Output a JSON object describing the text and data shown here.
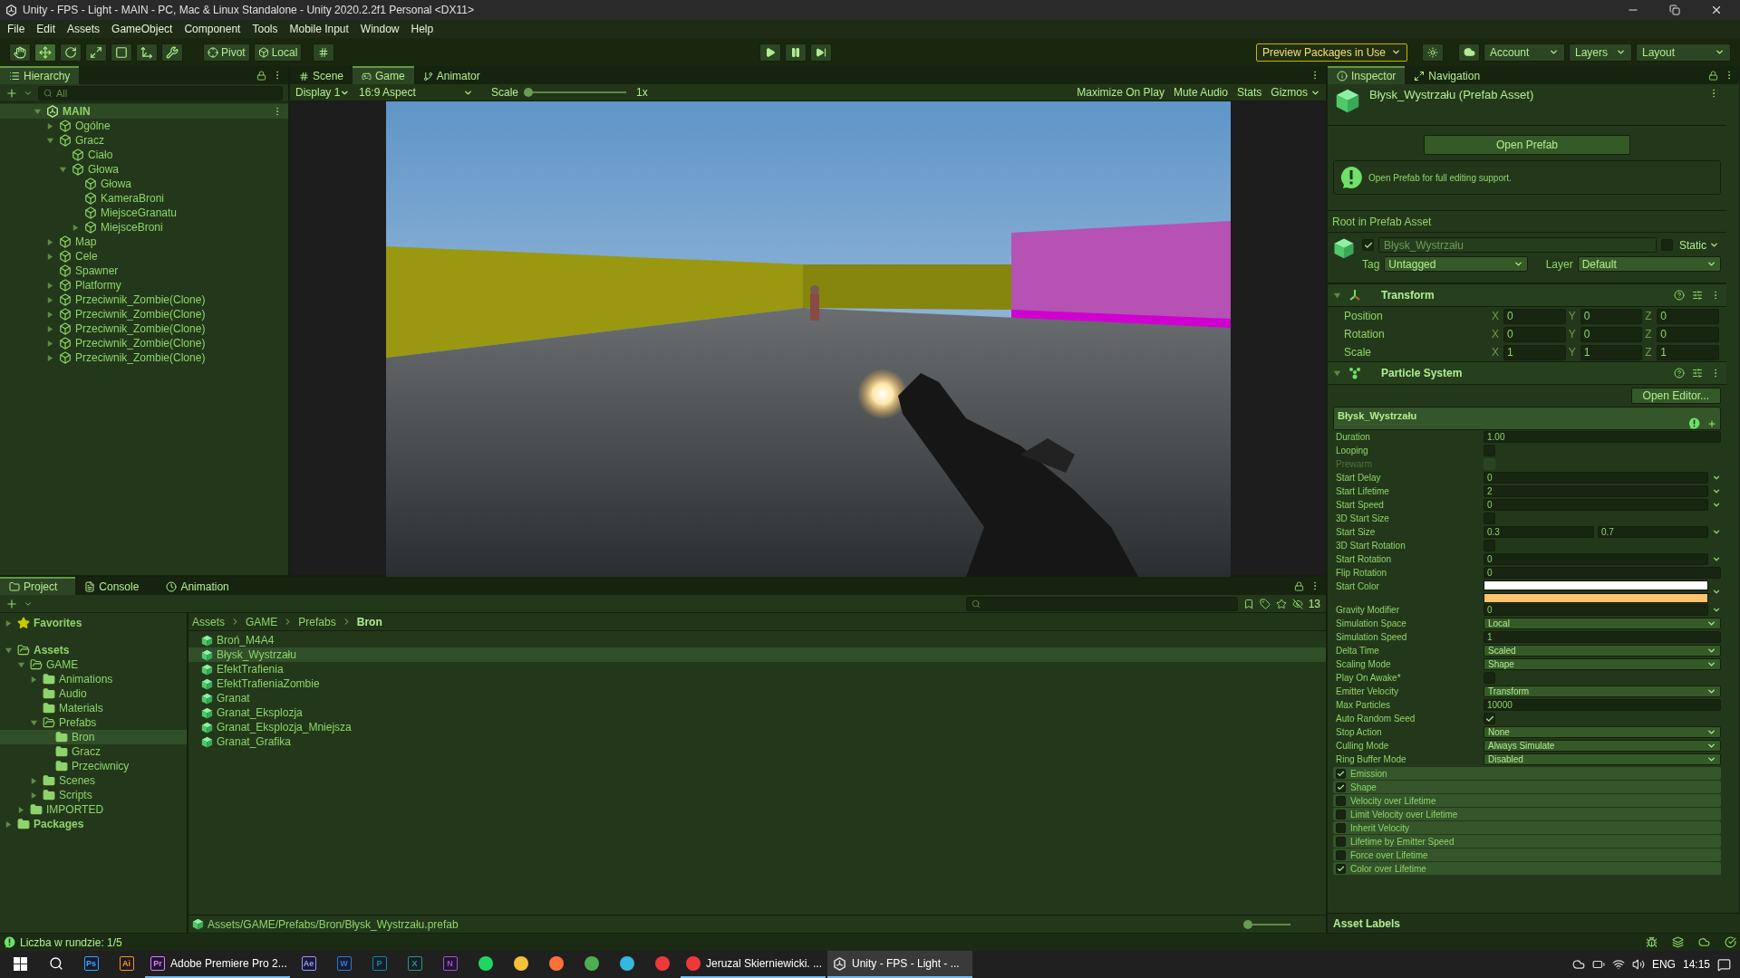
{
  "window": {
    "title": "Unity - FPS - Light - MAIN - PC, Mac & Linux Standalone - Unity 2020.2.2f1 Personal <DX11>"
  },
  "menu": [
    "File",
    "Edit",
    "Assets",
    "GameObject",
    "Component",
    "Tools",
    "Mobile Input",
    "Window",
    "Help"
  ],
  "toolbar": {
    "tools": [
      {
        "kind": "hand",
        "selected": false
      },
      {
        "kind": "move",
        "selected": true
      },
      {
        "kind": "rotate",
        "selected": false
      },
      {
        "kind": "scale",
        "selected": false
      },
      {
        "kind": "rect",
        "selected": false
      },
      {
        "kind": "transform",
        "selected": false
      },
      {
        "kind": "custom",
        "selected": false
      }
    ],
    "pivot": "Pivot",
    "local": "Local",
    "play_controls": [
      {
        "kind": "play"
      },
      {
        "kind": "pause"
      },
      {
        "kind": "step"
      }
    ],
    "packages": "Preview Packages in Use",
    "account": "Account",
    "layers": "Layers",
    "layout": "Layout"
  },
  "hierarchy": {
    "tab": "Hierarchy",
    "search": {
      "placeholder": "All"
    },
    "scene": {
      "label": "MAIN",
      "expanded": true,
      "children": [
        {
          "label": "Ogólne",
          "expanded": false
        },
        {
          "label": "Gracz",
          "expanded": true,
          "children": [
            {
              "label": "Ciało"
            },
            {
              "label": "Głowa",
              "expanded": true,
              "children": [
                {
                  "label": "Głowa"
                },
                {
                  "label": "KameraBroni"
                },
                {
                  "label": "MiejsceGranatu"
                },
                {
                  "label": "MiejsceBroni",
                  "expanded": false
                }
              ]
            }
          ]
        },
        {
          "label": "Map",
          "expanded": false
        },
        {
          "label": "Cele",
          "expanded": false
        },
        {
          "label": "Spawner"
        },
        {
          "label": "Platformy",
          "expanded": false
        },
        {
          "label": "Przeciwnik_Zombie(Clone)",
          "expanded": false
        },
        {
          "label": "Przeciwnik_Zombie(Clone)",
          "expanded": false
        },
        {
          "label": "Przeciwnik_Zombie(Clone)",
          "expanded": false
        },
        {
          "label": "Przeciwnik_Zombie(Clone)",
          "expanded": false
        },
        {
          "label": "Przeciwnik_Zombie(Clone)",
          "expanded": false
        }
      ]
    }
  },
  "center": {
    "tabs": [
      {
        "label": "Scene",
        "kind": "scene",
        "selected": false
      },
      {
        "label": "Game",
        "kind": "game",
        "selected": true
      },
      {
        "label": "Animator",
        "kind": "animator",
        "selected": false
      }
    ],
    "display": "Display 1",
    "aspect": "16:9 Aspect",
    "scale_label": "Scale",
    "scale": {
      "level": 0
    },
    "scale_value": "1x",
    "options": [
      "Maximize On Play",
      "Mute Audio",
      "Stats"
    ],
    "gizmos": "Gizmos"
  },
  "inspector": {
    "tabs": [
      {
        "label": "Inspector",
        "kind": "inspector",
        "selected": true
      },
      {
        "label": "Navigation",
        "kind": "navigation",
        "selected": false
      }
    ],
    "asset_title": "Błysk_Wystrzału (Prefab Asset)",
    "open_prefab": "Open Prefab",
    "help": "Open Prefab for full editing support.",
    "root_label": "Root in Prefab Asset",
    "object": {
      "active": true,
      "name": "Błysk_Wystrzału",
      "static": false,
      "static_label": "Static",
      "tag_label": "Tag",
      "tag": "Untagged",
      "layer_label": "Layer",
      "layer": "Default"
    },
    "transform": {
      "title": "Transform",
      "expanded": true,
      "rows": [
        {
          "label": "Position",
          "fields": [
            {
              "axis": "X",
              "value": "0"
            },
            {
              "axis": "Y",
              "value": "0"
            },
            {
              "axis": "Z",
              "value": "0"
            }
          ]
        },
        {
          "label": "Rotation",
          "fields": [
            {
              "axis": "X",
              "value": "0"
            },
            {
              "axis": "Y",
              "value": "0"
            },
            {
              "axis": "Z",
              "value": "0"
            }
          ]
        },
        {
          "label": "Scale",
          "fields": [
            {
              "axis": "X",
              "value": "1"
            },
            {
              "axis": "Y",
              "value": "1"
            },
            {
              "axis": "Z",
              "value": "1"
            }
          ]
        }
      ]
    },
    "particle_system": {
      "title": "Particle System",
      "expanded": true,
      "open_editor": "Open Editor...",
      "system_name": "Błysk_Wystrzału",
      "properties": [
        {
          "kind": "field",
          "label": "Duration",
          "value": "1.00"
        },
        {
          "kind": "toggle",
          "label": "Looping",
          "checked": false,
          "disabled": false
        },
        {
          "kind": "toggle",
          "label": "Prewarm",
          "checked": false,
          "disabled": true
        },
        {
          "kind": "curve",
          "label": "Start Delay",
          "value": "0"
        },
        {
          "kind": "curve",
          "label": "Start Lifetime",
          "value": "2"
        },
        {
          "kind": "curve",
          "label": "Start Speed",
          "value": "0"
        },
        {
          "kind": "toggle",
          "label": "3D Start Size",
          "checked": false,
          "disabled": false
        },
        {
          "kind": "pair",
          "label": "Start Size",
          "values": [
            "0.3",
            "0.7"
          ]
        },
        {
          "kind": "toggle",
          "label": "3D Start Rotation",
          "checked": false,
          "disabled": false
        },
        {
          "kind": "curve",
          "label": "Start Rotation",
          "value": "0"
        },
        {
          "kind": "field",
          "label": "Flip Rotation",
          "value": "0"
        },
        {
          "kind": "gradient",
          "label": "Start Color",
          "swatches": [
            {
              "color": "#ffffff"
            },
            {
              "color": "#ffc36e"
            }
          ]
        },
        {
          "kind": "curve",
          "label": "Gravity Modifier",
          "value": "0"
        },
        {
          "kind": "dropdown",
          "label": "Simulation Space",
          "value": "Local"
        },
        {
          "kind": "field",
          "label": "Simulation Speed",
          "value": "1"
        },
        {
          "kind": "dropdown",
          "label": "Delta Time",
          "value": "Scaled"
        },
        {
          "kind": "dropdown",
          "label": "Scaling Mode",
          "value": "Shape"
        },
        {
          "kind": "toggle",
          "label": "Play On Awake*",
          "checked": false,
          "disabled": false
        },
        {
          "kind": "dropdown",
          "label": "Emitter Velocity",
          "value": "Transform"
        },
        {
          "kind": "field",
          "label": "Max Particles",
          "value": "10000"
        },
        {
          "kind": "toggle",
          "label": "Auto Random Seed",
          "checked": true,
          "disabled": false
        },
        {
          "kind": "dropdown",
          "label": "Stop Action",
          "value": "None"
        },
        {
          "kind": "dropdown",
          "label": "Culling Mode",
          "value": "Always Simulate"
        },
        {
          "kind": "dropdown",
          "label": "Ring Buffer Mode",
          "value": "Disabled"
        }
      ],
      "modules": [
        {
          "label": "Emission",
          "checked": true
        },
        {
          "label": "Shape",
          "checked": true
        },
        {
          "label": "Velocity over Lifetime",
          "checked": false
        },
        {
          "label": "Limit Velocity over Lifetime",
          "checked": false
        },
        {
          "label": "Inherit Velocity",
          "checked": false
        },
        {
          "label": "Lifetime by Emitter Speed",
          "checked": false
        },
        {
          "label": "Force over Lifetime",
          "checked": false
        },
        {
          "label": "Color over Lifetime",
          "checked": true
        }
      ]
    },
    "asset_labels": "Asset Labels"
  },
  "project": {
    "tabs": [
      {
        "label": "Project",
        "kind": "project",
        "selected": true
      },
      {
        "label": "Console",
        "kind": "console",
        "selected": false
      },
      {
        "label": "Animation",
        "kind": "animation",
        "selected": false
      }
    ],
    "hidden_count": "13",
    "favorites": {
      "label": "Favorites",
      "expanded": false
    },
    "tree": [
      {
        "label": "Assets",
        "expanded": true,
        "selected": false,
        "children": [
          {
            "label": "GAME",
            "expanded": true,
            "selected": false,
            "children": [
              {
                "label": "Animations",
                "expanded": false,
                "selected": false
              },
              {
                "label": "Audio",
                "selected": false
              },
              {
                "label": "Materials",
                "selected": false
              },
              {
                "label": "Prefabs",
                "expanded": true,
                "selected": false,
                "children": [
                  {
                    "label": "Bron",
                    "selected": true
                  },
                  {
                    "label": "Gracz",
                    "selected": false
                  },
                  {
                    "label": "Przeciwnicy",
                    "selected": false
                  }
                ]
              },
              {
                "label": "Scenes",
                "expanded": false,
                "selected": false
              },
              {
                "label": "Scripts",
                "expanded": false,
                "selected": false
              }
            ]
          },
          {
            "label": "IMPORTED",
            "expanded": false,
            "selected": false
          }
        ]
      },
      {
        "label": "Packages",
        "expanded": false,
        "selected": false
      }
    ],
    "breadcrumb": [
      "Assets",
      "GAME",
      "Prefabs",
      "Bron"
    ],
    "files": [
      {
        "label": "Broń_M4A4",
        "selected": false
      },
      {
        "label": "Błysk_Wystrzału",
        "selected": true
      },
      {
        "label": "EfektTrafienia",
        "selected": false
      },
      {
        "label": "EfektTrafieniaZombie",
        "selected": false
      },
      {
        "label": "Granat",
        "selected": false
      },
      {
        "label": "Granat_Eksplozja",
        "selected": false
      },
      {
        "label": "Granat_Eksplozja_Mniejsza",
        "selected": false
      },
      {
        "label": "Granat_Grafika",
        "selected": false
      }
    ],
    "path": "Assets/GAME/Prefabs/Bron/Błysk_Wystrzału.prefab",
    "zoom": {
      "level": 0.05
    }
  },
  "status": {
    "message": "Liczba w rundzie: 1/5"
  },
  "taskbar": {
    "apps": [
      {
        "kind": "search",
        "selected": false
      },
      {
        "kind": "ps",
        "glyph": "Ps",
        "selected": false
      },
      {
        "kind": "ai",
        "glyph": "Ai",
        "selected": false
      },
      {
        "kind": "pr",
        "glyph": "Pr",
        "label": "Adobe Premiere Pro 2...",
        "selected": false
      },
      {
        "kind": "ae",
        "glyph": "Ae",
        "selected": false
      },
      {
        "kind": "word",
        "glyph": "W",
        "selected": false
      },
      {
        "kind": "publisher",
        "glyph": "P",
        "selected": false
      },
      {
        "kind": "excel",
        "glyph": "X",
        "selected": false
      },
      {
        "kind": "onenote",
        "glyph": "N",
        "selected": false
      },
      {
        "kind": "spotify",
        "selected": false
      },
      {
        "kind": "explorer",
        "selected": false
      },
      {
        "kind": "firefox",
        "selected": false
      },
      {
        "kind": "chrome",
        "selected": false
      },
      {
        "kind": "edge",
        "selected": false
      },
      {
        "kind": "vivaldi",
        "selected": false
      },
      {
        "kind": "vivaldi",
        "label": "Jeruzal Skierniewicki. ...",
        "selected": false
      },
      {
        "kind": "unity",
        "label": "Unity - FPS - Light - ...",
        "selected": true
      }
    ],
    "language": "ENG",
    "time": "14:15"
  }
}
